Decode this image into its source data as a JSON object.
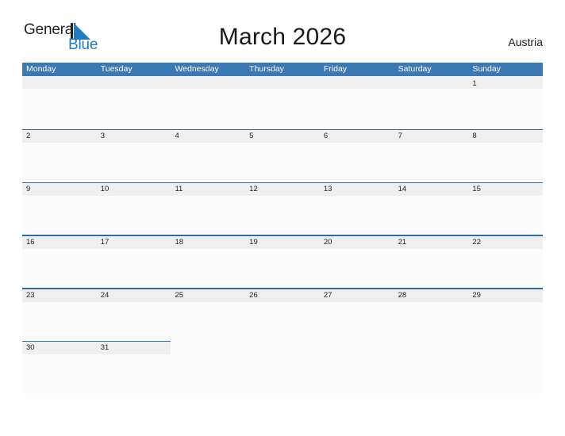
{
  "brand": {
    "word1": "General",
    "word2": "Blue",
    "sail_icon": "sail-triangle-icon",
    "color_dark": "#231f20",
    "color_blue": "#1e7bc4"
  },
  "header": {
    "title": "March 2026",
    "country": "Austria"
  },
  "calendar": {
    "header_bg": "#3a79b4",
    "band_bg": "#efefef",
    "rule_color": "#2e6da4",
    "day_names": [
      "Monday",
      "Tuesday",
      "Wednesday",
      "Thursday",
      "Friday",
      "Saturday",
      "Sunday"
    ],
    "weeks": [
      [
        "",
        "",
        "",
        "",
        "",
        "",
        "1"
      ],
      [
        "2",
        "3",
        "4",
        "5",
        "6",
        "7",
        "8"
      ],
      [
        "9",
        "10",
        "11",
        "12",
        "13",
        "14",
        "15"
      ],
      [
        "16",
        "17",
        "18",
        "19",
        "20",
        "21",
        "22"
      ],
      [
        "23",
        "24",
        "25",
        "26",
        "27",
        "28",
        "29"
      ],
      [
        "30",
        "31",
        "",
        "",
        "",
        "",
        ""
      ]
    ]
  }
}
